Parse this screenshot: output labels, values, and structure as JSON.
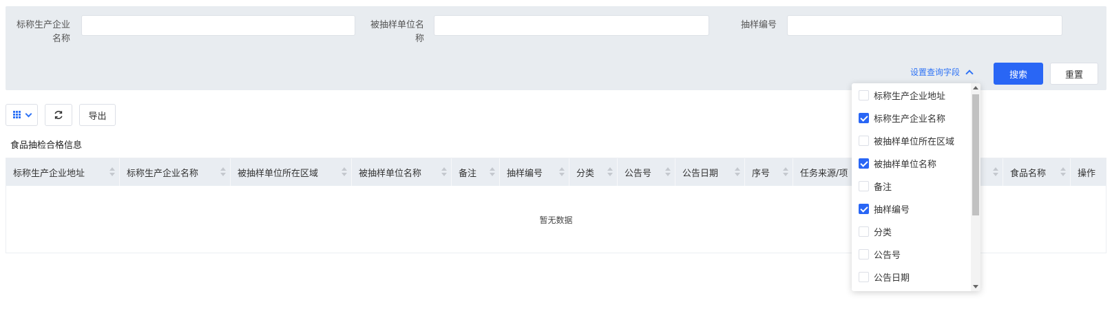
{
  "search": {
    "fields": [
      {
        "label_line1": "标称生产企业",
        "label_line2": "名称",
        "value": "",
        "placeholder": ""
      },
      {
        "label_line1": "被抽样单位名",
        "label_line2": "称",
        "value": "",
        "placeholder": ""
      },
      {
        "label_line1": "抽样编号",
        "label_line2": "",
        "value": "",
        "placeholder": ""
      }
    ],
    "set_fields_label": "设置查询字段",
    "search_button": "搜索",
    "reset_button": "重置"
  },
  "toolbar": {
    "export_label": "导出",
    "grid_icon": "grid-icon",
    "refresh_icon": "refresh-icon"
  },
  "table": {
    "title": "食品抽检合格信息",
    "columns": [
      "标称生产企业地址",
      "标称生产企业名称",
      "被抽样单位所在区域",
      "被抽样单位名称",
      "备注",
      "抽样编号",
      "分类",
      "公告号",
      "公告日期",
      "序号",
      "任务来源/项",
      "",
      "食品名称",
      "操作"
    ],
    "empty_text": "暂无数据"
  },
  "field_dropdown": {
    "items": [
      {
        "label": "标称生产企业地址",
        "checked": false
      },
      {
        "label": "标称生产企业名称",
        "checked": true
      },
      {
        "label": "被抽样单位所在区域",
        "checked": false
      },
      {
        "label": "被抽样单位名称",
        "checked": true
      },
      {
        "label": "备注",
        "checked": false
      },
      {
        "label": "抽样编号",
        "checked": true
      },
      {
        "label": "分类",
        "checked": false
      },
      {
        "label": "公告号",
        "checked": false
      },
      {
        "label": "公告日期",
        "checked": false
      }
    ]
  },
  "colors": {
    "primary": "#2966f5",
    "link": "#2f73f5",
    "panel_bg": "#e8ecf0",
    "header_bg": "#e9edf2"
  }
}
